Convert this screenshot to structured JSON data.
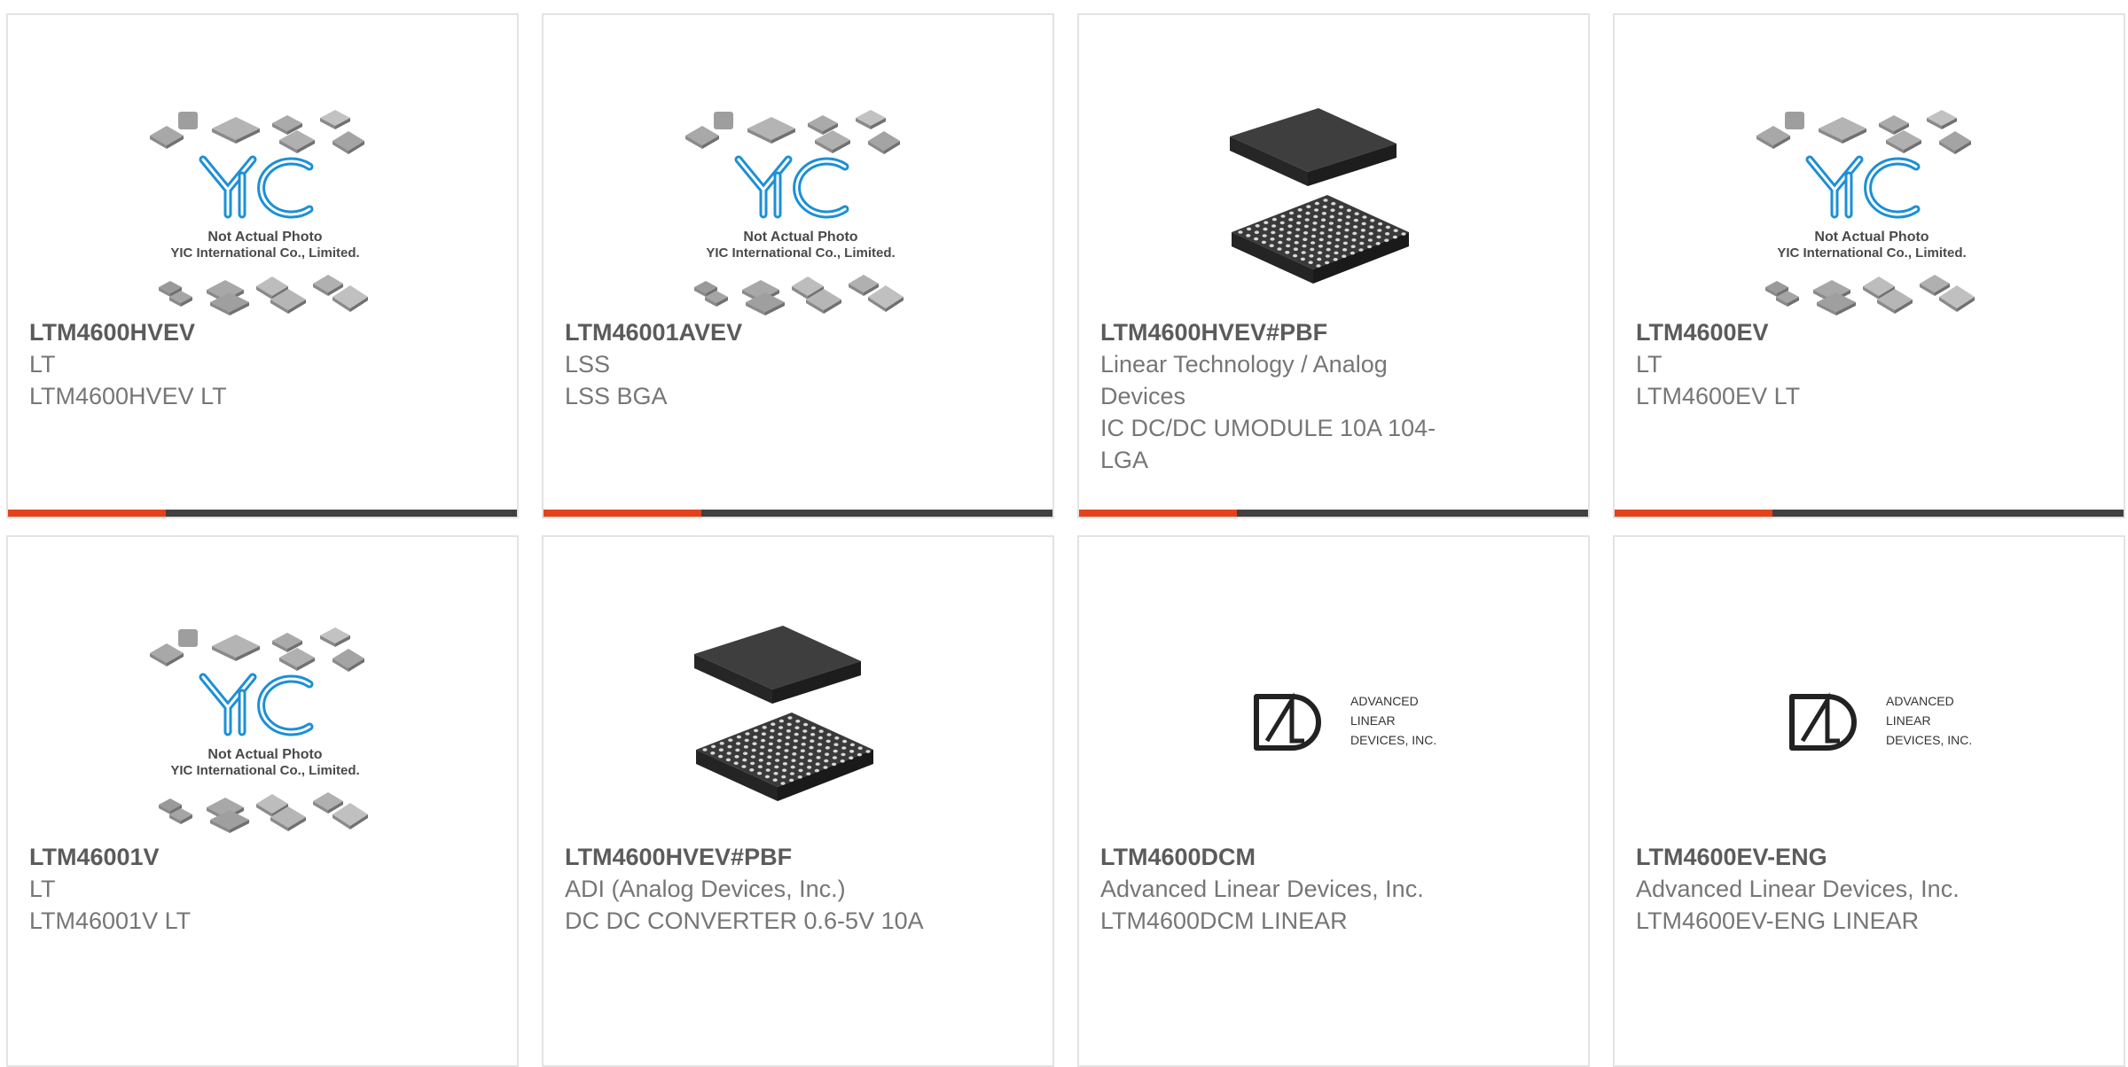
{
  "products": [
    {
      "part_number": "LTM4600HVEV",
      "manufacturer": "LT",
      "description": "LTM4600HVEV LT",
      "image": "placeholder",
      "placeholder_text": [
        "Not Actual Photo",
        "YIC International Co., Limited."
      ],
      "progress_fraction": 0.31
    },
    {
      "part_number": "LTM46001AVEV",
      "manufacturer": "LSS",
      "description": "LSS BGA",
      "image": "placeholder",
      "placeholder_text": [
        "Not Actual Photo",
        "YIC International Co., Limited."
      ],
      "progress_fraction": 0.31
    },
    {
      "part_number": "LTM4600HVEV#PBF",
      "manufacturer": "Linear Technology / Analog Devices",
      "description": "IC DC/DC UMODULE 10A 104-LGA",
      "image": "chip",
      "progress_fraction": 0.31
    },
    {
      "part_number": "LTM4600EV",
      "manufacturer": "LT",
      "description": "LTM4600EV LT",
      "image": "placeholder",
      "placeholder_text": [
        "Not Actual Photo",
        "YIC International Co., Limited."
      ],
      "progress_fraction": 0.31
    },
    {
      "part_number": "LTM46001V",
      "manufacturer": "LT",
      "description": "LTM46001V LT",
      "image": "placeholder",
      "placeholder_text": [
        "Not Actual Photo",
        "YIC International Co., Limited."
      ]
    },
    {
      "part_number": "LTM4600HVEV#PBF",
      "manufacturer": "ADI (Analog Devices, Inc.)",
      "description": "DC DC CONVERTER 0.6-5V 10A",
      "image": "chip"
    },
    {
      "part_number": "LTM4600DCM",
      "manufacturer": "Advanced Linear Devices, Inc.",
      "description": "LTM4600DCM LINEAR",
      "image": "ald-logo",
      "logo_text": [
        "ADVANCED",
        "LINEAR",
        "DEVICES, INC."
      ]
    },
    {
      "part_number": "LTM4600EV-ENG",
      "manufacturer": "Advanced Linear Devices, Inc.",
      "description": "LTM4600EV-ENG LINEAR",
      "image": "ald-logo",
      "logo_text": [
        "ADVANCED",
        "LINEAR",
        "DEVICES, INC."
      ]
    }
  ],
  "colors": {
    "accent": "#e2431c",
    "bar_dark": "#404040",
    "title_text": "#5b5b5b",
    "body_text": "#767676",
    "yic_blue": "#1c8fd6",
    "card_border": "#e3e3e3"
  }
}
